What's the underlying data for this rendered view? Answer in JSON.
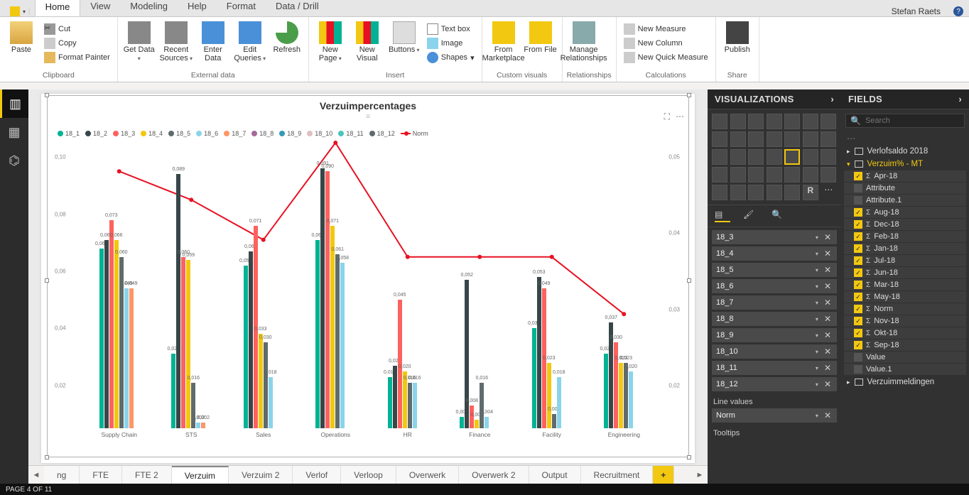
{
  "user": "Stefan Raets",
  "ribbon_tabs": [
    "Home",
    "View",
    "Modeling",
    "Help",
    "Format",
    "Data / Drill"
  ],
  "active_tab": "Home",
  "ribbon": {
    "clipboard": {
      "label": "Clipboard",
      "paste": "Paste",
      "cut": "Cut",
      "copy": "Copy",
      "fmt": "Format Painter"
    },
    "extdata": {
      "label": "External data",
      "getdata": "Get Data",
      "recent": "Recent Sources",
      "enter": "Enter Data",
      "edit": "Edit Queries",
      "refresh": "Refresh"
    },
    "insert": {
      "label": "Insert",
      "newpage": "New Page",
      "newvis": "New Visual",
      "buttons": "Buttons",
      "textbox": "Text box",
      "image": "Image",
      "shapes": "Shapes"
    },
    "custom": {
      "label": "Custom visuals",
      "market": "From Marketplace",
      "file": "From File"
    },
    "rel": {
      "label": "Relationships",
      "manage": "Manage Relationships"
    },
    "calc": {
      "label": "Calculations",
      "nm": "New Measure",
      "nc": "New Column",
      "nq": "New Quick Measure"
    },
    "share": {
      "label": "Share",
      "publish": "Publish"
    }
  },
  "page_tabs": [
    "ng",
    "FTE",
    "FTE 2",
    "Verzuim",
    "Verzuim 2",
    "Verlof",
    "Verloop",
    "Overwerk",
    "Overwerk 2",
    "Output",
    "Recruitment"
  ],
  "active_page_tab": "Verzuim",
  "status_text": "PAGE 4 OF 11",
  "viz_pane_title": "VISUALIZATIONS",
  "fields_pane_title": "FIELDS",
  "search_placeholder": "Search",
  "tables": [
    {
      "name": "Verlofsaldo 2018",
      "active": false,
      "expanded": false
    },
    {
      "name": "Verzuim% - MT",
      "active": true,
      "expanded": true
    },
    {
      "name": "Verzuimmeldingen",
      "active": false,
      "expanded": false
    }
  ],
  "fields": [
    {
      "name": "Apr-18",
      "checked": true,
      "sigma": true
    },
    {
      "name": "Attribute",
      "checked": false,
      "sigma": false
    },
    {
      "name": "Attribute.1",
      "checked": false,
      "sigma": false
    },
    {
      "name": "Aug-18",
      "checked": true,
      "sigma": true
    },
    {
      "name": "Dec-18",
      "checked": true,
      "sigma": true
    },
    {
      "name": "Feb-18",
      "checked": true,
      "sigma": true
    },
    {
      "name": "Jan-18",
      "checked": true,
      "sigma": true
    },
    {
      "name": "Jul-18",
      "checked": true,
      "sigma": true
    },
    {
      "name": "Jun-18",
      "checked": true,
      "sigma": true
    },
    {
      "name": "Mar-18",
      "checked": true,
      "sigma": true
    },
    {
      "name": "May-18",
      "checked": true,
      "sigma": true
    },
    {
      "name": "Norm",
      "checked": true,
      "sigma": true
    },
    {
      "name": "Nov-18",
      "checked": true,
      "sigma": true
    },
    {
      "name": "Okt-18",
      "checked": true,
      "sigma": true
    },
    {
      "name": "Sep-18",
      "checked": true,
      "sigma": true
    },
    {
      "name": "Value",
      "checked": false,
      "sigma": false
    },
    {
      "name": "Value.1",
      "checked": false,
      "sigma": false
    }
  ],
  "wells": [
    "18_3",
    "18_4",
    "18_5",
    "18_6",
    "18_7",
    "18_8",
    "18_9",
    "18_10",
    "18_11",
    "18_12"
  ],
  "line_values_label": "Line values",
  "line_values_item": "Norm",
  "tooltips_label": "Tooltips",
  "chart_data": {
    "type": "bar",
    "title": "Verzuimpercentages",
    "series_colors": [
      "#00b294",
      "#374649",
      "#fd625e",
      "#f2c80f",
      "#5f6b6d",
      "#8ad4eb",
      "#fe9666",
      "#a66999",
      "#3599b8",
      "#dfbfbf",
      "#4ac5bb",
      "#5f6b6d"
    ],
    "legend": [
      "18_1",
      "18_2",
      "18_3",
      "18_4",
      "18_5",
      "18_6",
      "18_7",
      "18_8",
      "18_9",
      "18_10",
      "18_11",
      "18_12",
      "Norm"
    ],
    "categories": [
      "Supply Chain",
      "STS",
      "Sales",
      "Operations",
      "HR",
      "Finance",
      "Facility",
      "Engineering"
    ],
    "y_left_ticks": [
      "0,10",
      "0,08",
      "0,06",
      "0,04",
      "0,02"
    ],
    "y_right_ticks": [
      "0,05",
      "0,04",
      "0,03",
      "0,02"
    ],
    "ymax": 0.1,
    "series": [
      {
        "name": "18_1",
        "values": [
          0.063,
          0.026,
          0.057,
          0.066,
          0.018,
          0.004,
          0.035,
          0.026
        ]
      },
      {
        "name": "18_2",
        "values": [
          0.066,
          0.089,
          0.062,
          0.091,
          0.022,
          0.052,
          0.053,
          0.037
        ]
      },
      {
        "name": "18_3",
        "values": [
          0.073,
          0.06,
          0.071,
          0.09,
          0.045,
          0.008,
          0.049,
          0.03
        ]
      },
      {
        "name": "18_4",
        "values": [
          0.066,
          0.059,
          0.033,
          0.071,
          0.02,
          0.003,
          0.023,
          0.023
        ]
      },
      {
        "name": "18_5",
        "values": [
          0.06,
          0.016,
          0.03,
          0.061,
          0.016,
          0.016,
          0.005,
          0.023
        ]
      },
      {
        "name": "18_6",
        "values": [
          0.049,
          0.002,
          0.018,
          0.058,
          0.016,
          0.004,
          0.018,
          0.02
        ]
      },
      {
        "name": "18_7",
        "values": [
          0.049,
          0.002,
          null,
          null,
          null,
          null,
          null,
          null
        ]
      }
    ],
    "norm": [
      0.045,
      0.04,
      0.033,
      0.05,
      0.03,
      0.03,
      0.03,
      0.02
    ]
  }
}
